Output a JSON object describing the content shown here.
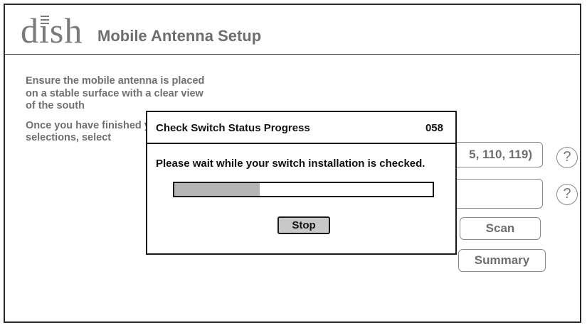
{
  "header": {
    "logo_text": "dish",
    "title": "Mobile Antenna Setup"
  },
  "instructions": {
    "paragraph1": "Ensure the mobile antenna is placed on a stable surface with a clear view of the south",
    "paragraph2": "Once you have finished your selections, select"
  },
  "settings": {
    "satellites_value": "5, 110, 119)",
    "second_field_value": "",
    "scan_label": "Scan",
    "summary_label": "Summary",
    "help_symbol": "?"
  },
  "dialog": {
    "title": "Check Switch Status Progress",
    "code": "058",
    "message": "Please wait while your switch installation is checked.",
    "progress_fraction": 0.33,
    "stop_label": "Stop"
  },
  "colors": {
    "background": "#ffffff",
    "text_gray": "#707070",
    "dialog_border": "#1a1a1a",
    "progress_fill": "#b5b5b5",
    "stop_button": "#c8c8c8"
  }
}
